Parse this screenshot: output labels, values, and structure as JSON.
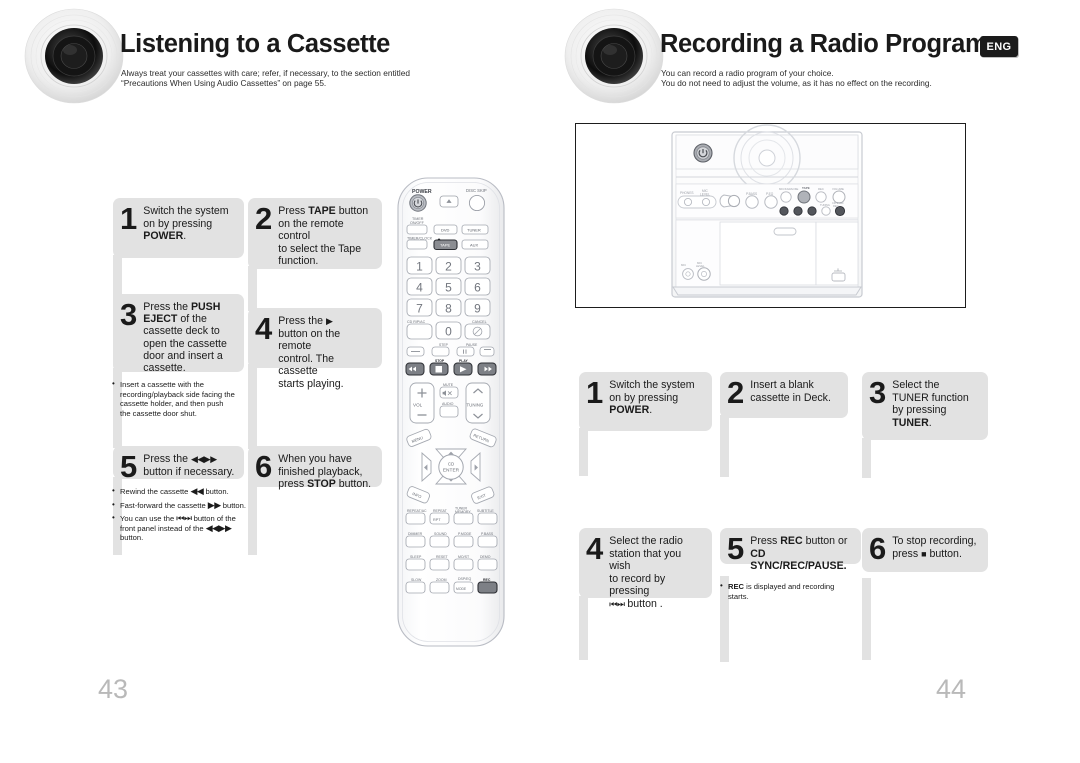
{
  "left_page": {
    "header": {
      "title": "Listening to a Cassette",
      "subtitle_line1": "Always treat your cassettes with care; refer, if necessary, to the section entitled",
      "subtitle_line2": "“Precautions When Using Audio Cassettes” on page 55."
    },
    "steps": [
      {
        "num": "1",
        "html": "Switch the system<br>on by pressing<br><b>POWER</b>."
      },
      {
        "num": "2",
        "html": "Press <b>TAPE</b> button<br>on the remote control<br>to select the Tape<br>function."
      },
      {
        "num": "3",
        "html": "Press the <b>PUSH</b><br><b>EJECT</b> of the<br>cassette deck to<br>open the cassette<br>door and insert a<br>cassette."
      },
      {
        "num": "4",
        "html": "Press the <span class=\"g\">▶</span><br>button on the remote<br>control. The cassette<br>starts playing."
      },
      {
        "num": "5",
        "html": "Press the <span class=\"g\">◀◀ ▶▶</span><br>button if necessary."
      },
      {
        "num": "6",
        "html": "When you have<br>finished playback,<br>press <b>STOP</b> button."
      }
    ],
    "notes_step3": [
      "Insert a cassette with the recording/playback side facing the cassette holder, and then push the cassette door shut."
    ],
    "notes_step5": [
      "Rewind the cassette <span class=\"g\">◀◀</span> button.",
      "Fast-forward the cassette <span class=\"g\">▶▶</span> button.",
      "You can use the <span class=\"g\">⏮ ⏭</span> button of the front panel instead of the <span class=\"g\">◀◀ ▶▶</span> button."
    ],
    "page_number": "43"
  },
  "right_page": {
    "header": {
      "title": "Recording a Radio Program",
      "badge": "ENG",
      "subtitle_line1": "You can record a radio program of your choice.",
      "subtitle_line2": "You do not need to adjust the volume, as it has no effect on the recording."
    },
    "steps": [
      {
        "num": "1",
        "html": "Switch the system<br>on by pressing<br><b>POWER</b>."
      },
      {
        "num": "2",
        "html": "Insert a blank<br>cassette in Deck."
      },
      {
        "num": "3",
        "html": "Select the<br>TUNER function<br>by pressing<br><b>TUNER</b>."
      },
      {
        "num": "4",
        "html": "Select the radio<br>station that you wish<br>to record by pressing<br><span class=\"g\">⏮ ⏭</span> button ."
      },
      {
        "num": "5",
        "html": "Press <b>REC</b> button or<br><b>CD SYNC/REC/PAUSE.</b>"
      },
      {
        "num": "6",
        "html": "To stop recording,<br>press <span class=\"g-sq\">■</span> button."
      }
    ],
    "notes_step5": [
      "<b>REC</b> is displayed and recording starts."
    ],
    "page_number": "44"
  },
  "remote": {
    "labels": {
      "power": "POWER",
      "open_close": "OPEN/CLOSE",
      "disc_skip": "DISC SKIP",
      "timer_onoff": "TIMER\nON/OFF",
      "timer_clock": "TIMER/CLOCK",
      "dvd": "DVD",
      "tuner": "TUNER",
      "tape": "TAPE",
      "aux": "AUX",
      "cd_rip": "CD RIP/AC",
      "cancel": "CANCEL",
      "step": "STEP",
      "pause": "PAUSE",
      "stop": "STOP",
      "play": "PLAY",
      "vol": "VOL",
      "mute": "MUTE",
      "audio": "AUDIO",
      "tuning": "TUNING",
      "menu": "MENU",
      "return": "RETURN",
      "cd_enter": "CD\nENTER",
      "info": "INFO",
      "exit": "EXIT",
      "repeat_ac": "REPEAT/AC",
      "repeat": "REPEAT",
      "tuner_memory": "TUNER\nMEMORY",
      "subtitle": "SUBTITLE",
      "dimmer": "DIMMER",
      "sound": "SOUND",
      "p_mode": "P.MODE",
      "p_bass": "P.BASS",
      "sleep": "SLEEP",
      "reset": "RESET",
      "mo_st": "MO/ST",
      "demo": "DEMO",
      "slow": "SLOW",
      "zoom": "ZOOM",
      "dsp_eq": "DSP/EQ",
      "rec": "REC"
    },
    "numbers": [
      "1",
      "2",
      "3",
      "4",
      "5",
      "6",
      "7",
      "8",
      "9",
      "0"
    ]
  },
  "colors": {
    "step_box": "#e2e2e2",
    "text": "#1b1b1b",
    "page_number": "#b9b9b9",
    "badge_bg": "#1b1b1b",
    "highlight_button": "#8c8c8c"
  }
}
